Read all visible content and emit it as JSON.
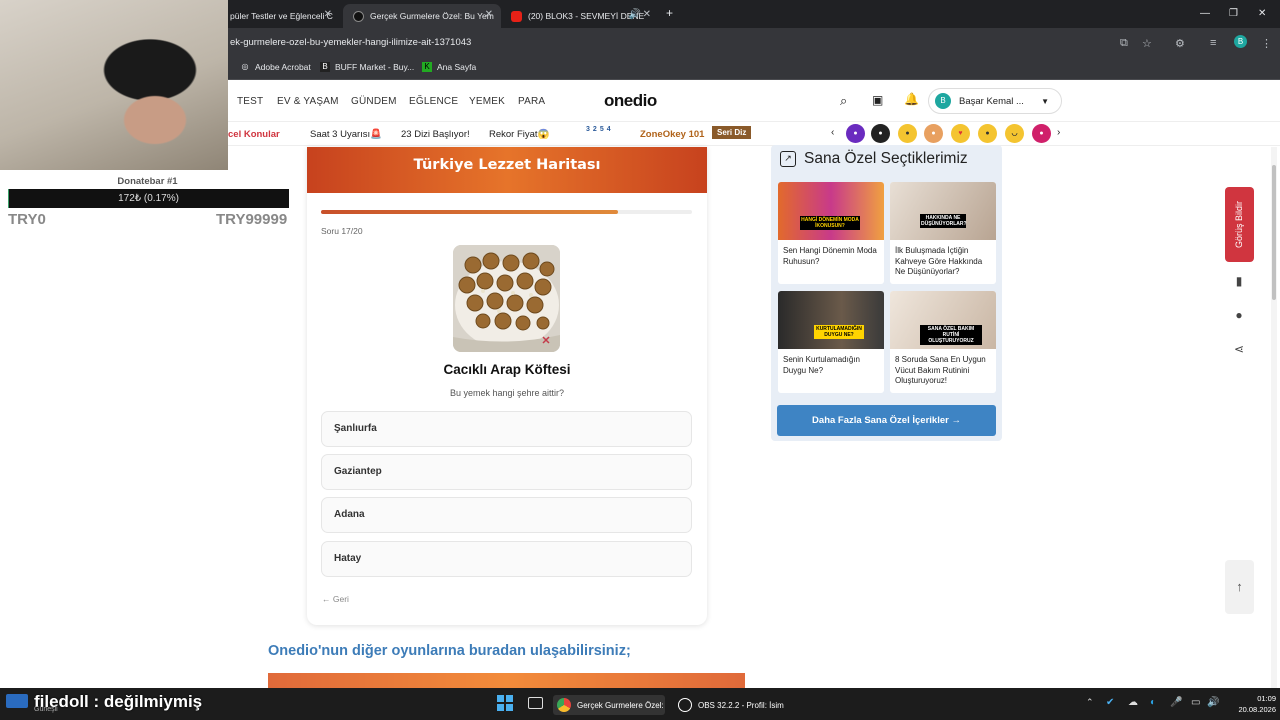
{
  "browser": {
    "tabs": [
      {
        "label": "püler Testler ve Eğlenceli C",
        "active": false
      },
      {
        "label": "Gerçek Gurmelere Özel: Bu Yem",
        "active": true
      },
      {
        "label": "(20) BLOK3 - SEVMEYİ DENE",
        "active": false
      }
    ],
    "url": "ek-gurmelere-ozel-bu-yemekler-hangi-ilimize-ait-1371043",
    "bookmarks": [
      "Adobe Acrobat",
      "BUFF Market - Buy...",
      "Ana Sayfa"
    ],
    "profile_initial": "B"
  },
  "site": {
    "nav": [
      "TEST",
      "EV & YAŞAM",
      "GÜNDEM",
      "EĞLENCE",
      "YEMEK",
      "PARA"
    ],
    "logo": "onedio",
    "user": {
      "initial": "B",
      "name": "Başar Kemal ..."
    },
    "subnav": [
      "cel Konular",
      "Saat 3 Uyarısı🚨",
      "23 Dizi Başlıyor!",
      "Rekor Fiyat😱"
    ],
    "zone": {
      "digits": [
        "3",
        "2",
        "5",
        "4"
      ],
      "label": "ZoneOkey 101",
      "badge": "Seri Diz"
    }
  },
  "donate": {
    "title": "Donatebar #1",
    "amount": "172₺ (0.17%)",
    "fraction": 0.0017,
    "min": "TRY0",
    "max": "TRY99999"
  },
  "quiz": {
    "title": "Türkiye Lezzet Haritası",
    "counter": "Soru 17/20",
    "progress": 0.8,
    "food": "Cacıklı Arap Köftesi",
    "question": "Bu yemek hangi şehre aittir?",
    "options": [
      "Şanlıurfa",
      "Gaziantep",
      "Adana",
      "Hatay"
    ],
    "back": "← Geri"
  },
  "other_games": "Onedio'nun diğer oyunlarına buradan ulaşabilirsiniz;",
  "recs": {
    "title": "Sana Özel Seçtiklerimiz",
    "cards": [
      {
        "caption": "Sen Hangi Dönemin Moda Ruhusun?",
        "overlay": "HANGİ DÖNEMİN MODA İKONUSUN?"
      },
      {
        "caption": "İlk Buluşmada İçtiğin Kahveye Göre Hakkında Ne Düşünüyorlar?",
        "overlay": "HAKKINDA NE DÜŞÜNÜYORLAR?"
      },
      {
        "caption": "Senin Kurtulamadığın Duygu Ne?",
        "overlay": "KURTULAMADIĞIN DUYGU NE?"
      },
      {
        "caption": "8 Soruda Sana En Uygun Vücut Bakım Rutinini Oluşturuyoruz!",
        "overlay": "SANA ÖZEL BAKIM RUTİNİ OLUŞTURUYORUZ"
      }
    ],
    "more": "Daha Fazla Sana Özel İçerikler →"
  },
  "feedback": "Görüş Bildir",
  "taskbar": {
    "overlay": "filedoll : değilmiymiş",
    "weather_sub": "Güneşli",
    "apps": [
      "Gerçek Gurmelere Özel:",
      "OBS 32.2.2 - Profil: İsim"
    ],
    "time": "01:09",
    "date": "20.08.2026"
  },
  "colors": {
    "accent": "#c7421e",
    "link": "#3d7cb8",
    "button": "#3e84c4",
    "feedback": "#d0353f"
  }
}
